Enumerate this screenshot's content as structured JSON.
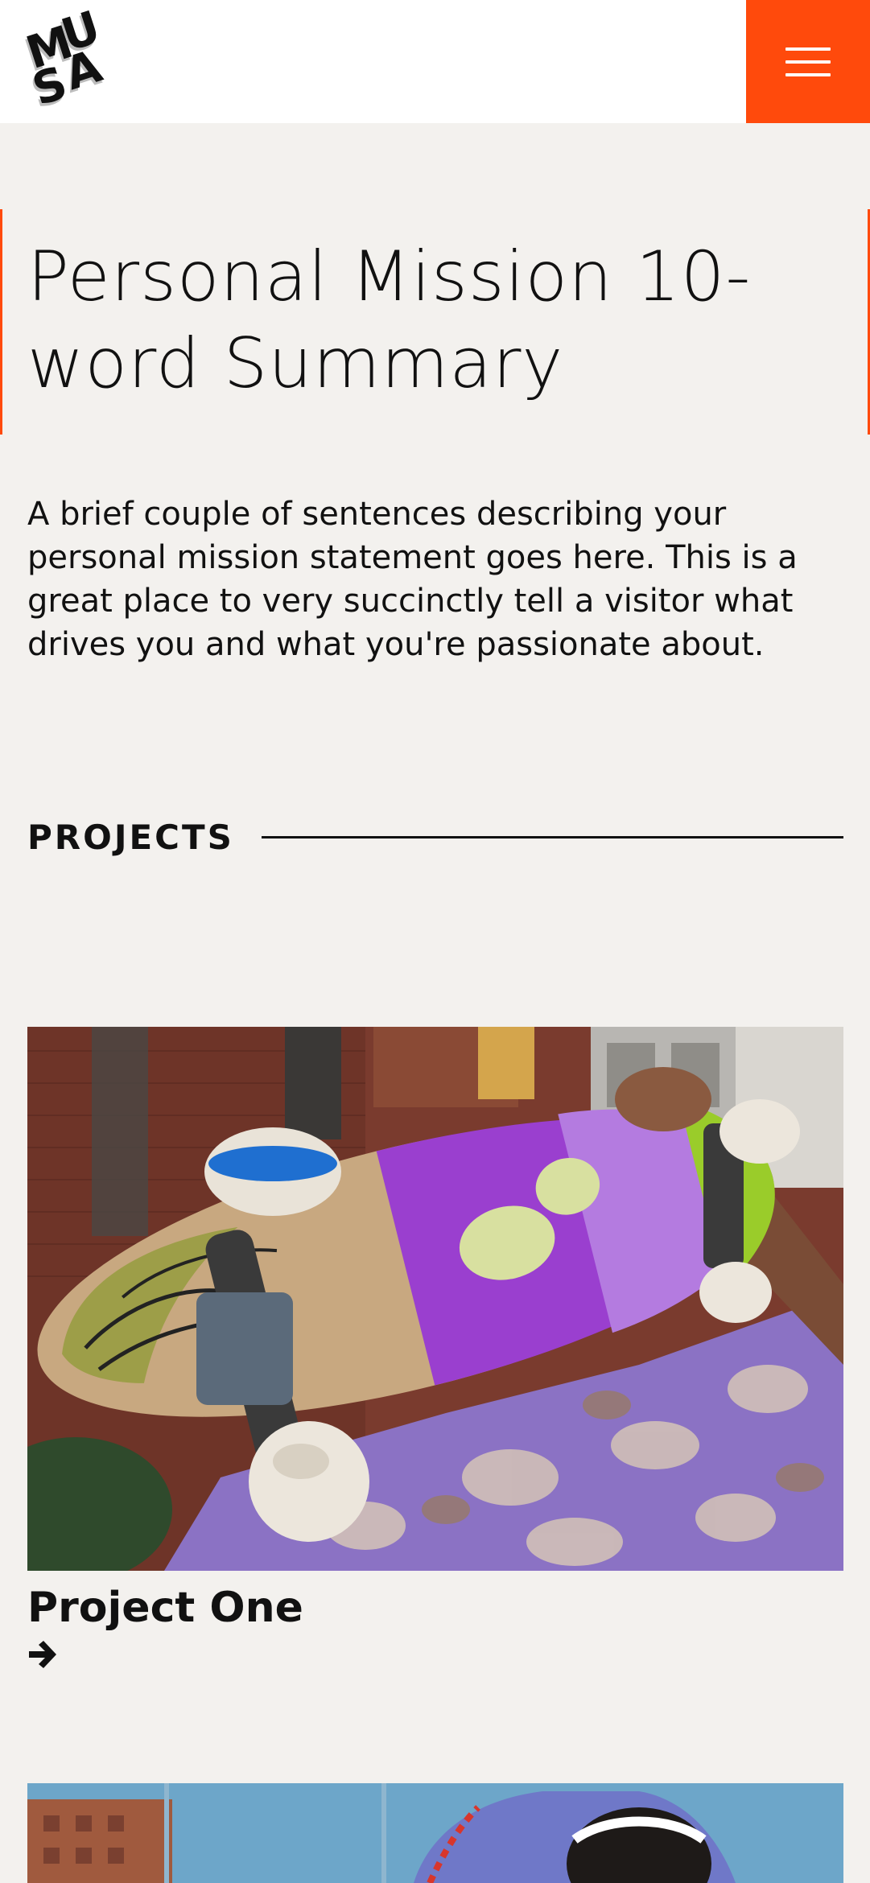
{
  "header": {
    "logo_text": "MUSA",
    "menu_icon": "hamburger-menu-icon"
  },
  "hero": {
    "title": "Personal Mission 10-word Summary",
    "intro": "A brief couple of sentences describing your personal mission statement goes here. This is a great place to very succinctly tell a visitor what drives you and what you're passionate about."
  },
  "projects": {
    "heading": "PROJECTS",
    "items": [
      {
        "title": "Project One",
        "arrow_icon": "arrow-right-icon",
        "image": "skateboard-photo"
      },
      {
        "title": "",
        "image": "basketball-player-photo"
      }
    ]
  },
  "colors": {
    "accent": "#ff4a0c",
    "background": "#f3f1ee",
    "header_bg": "#ffffff",
    "text": "#111111"
  }
}
